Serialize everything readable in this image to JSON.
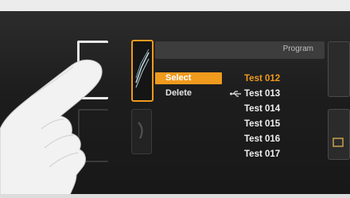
{
  "header": {
    "title": "Program"
  },
  "menu": {
    "items": [
      {
        "label": "Select",
        "selected": true
      },
      {
        "label": "Delete",
        "selected": false
      }
    ]
  },
  "list": {
    "items": [
      {
        "label": "Test 012",
        "highlighted": true,
        "icon": null
      },
      {
        "label": "Test 013",
        "highlighted": false,
        "icon": "usb-icon"
      },
      {
        "label": "Test 014",
        "highlighted": false,
        "icon": null
      },
      {
        "label": "Test 015",
        "highlighted": false,
        "icon": null
      },
      {
        "label": "Test 016",
        "highlighted": false,
        "icon": null
      },
      {
        "label": "Test 017",
        "highlighted": false,
        "icon": null
      }
    ]
  },
  "colors": {
    "accent": "#f09a1e",
    "text": "#f0f0f0",
    "screen": "#1d1d1d"
  }
}
